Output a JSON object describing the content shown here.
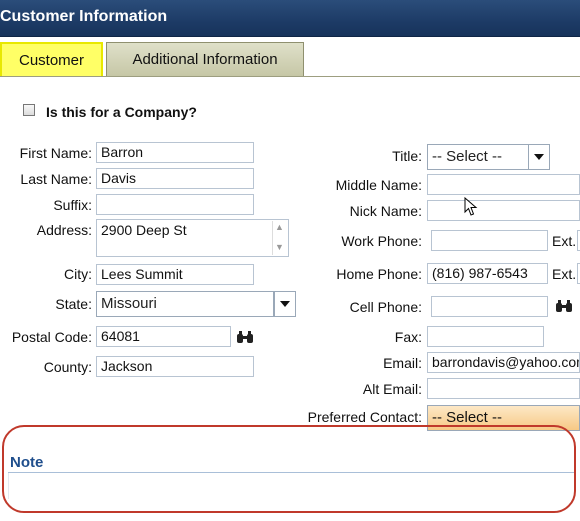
{
  "window": {
    "title": "Customer Information"
  },
  "tabs": [
    {
      "label": "Customer"
    },
    {
      "label": "Additional Information"
    }
  ],
  "company_check": {
    "label": "Is this for a Company?",
    "checked": false
  },
  "left_form": {
    "first_name": {
      "label": "First Name:",
      "value": "Barron"
    },
    "last_name": {
      "label": "Last Name:",
      "value": "Davis"
    },
    "suffix": {
      "label": "Suffix:",
      "value": ""
    },
    "address": {
      "label": "Address:",
      "value": "2900 Deep St"
    },
    "city": {
      "label": "City:",
      "value": "Lees Summit"
    },
    "state": {
      "label": "State:",
      "value": "Missouri"
    },
    "postal_code": {
      "label": "Postal Code:",
      "value": "64081"
    },
    "county": {
      "label": "County:",
      "value": "Jackson"
    }
  },
  "right_form": {
    "title": {
      "label": "Title:",
      "value": "-- Select --"
    },
    "middle_name": {
      "label": "Middle Name:",
      "value": ""
    },
    "nick_name": {
      "label": "Nick Name:",
      "value": ""
    },
    "work_phone": {
      "label": "Work Phone:",
      "value": "",
      "ext_label": "Ext."
    },
    "home_phone": {
      "label": "Home Phone:",
      "value": "(816) 987-6543",
      "ext_label": "Ext."
    },
    "cell_phone": {
      "label": "Cell Phone:",
      "value": ""
    },
    "fax": {
      "label": "Fax:",
      "value": ""
    },
    "email": {
      "label": "Email:",
      "value": "barrondavis@yahoo.com"
    },
    "alt_email": {
      "label": "Alt Email:",
      "value": ""
    },
    "preferred_contact": {
      "label": "Preferred Contact:",
      "value": "-- Select --"
    }
  },
  "note": {
    "title": "Note",
    "value": ""
  },
  "icons": {
    "lookup": "binoculars-icon",
    "dropdown": "chevron-down-icon"
  },
  "colors": {
    "titlebar": "#1d3b66",
    "active_tab": "#ffff66",
    "highlight_oval": "#c0392b",
    "note_title": "#1f4e8c"
  }
}
